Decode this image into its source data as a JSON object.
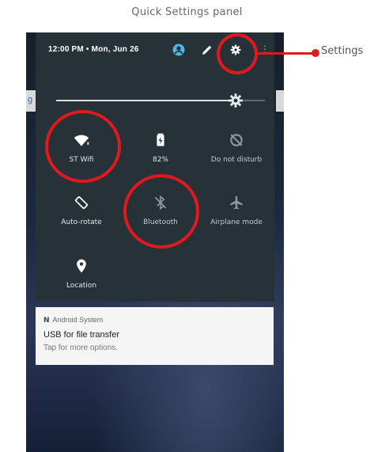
{
  "caption": "Quick Settings panel",
  "status_bar": {
    "datetime": "12:00 PM • Mon, Jun 26",
    "more": "⋮"
  },
  "brightness": {
    "level": 0.86
  },
  "tiles": [
    {
      "label": "ST Wifi",
      "icon": "wifi-icon"
    },
    {
      "label": "82%",
      "icon": "battery-icon"
    },
    {
      "label": "Do not disturb",
      "icon": "do-not-disturb-icon"
    },
    {
      "label": "Auto-rotate",
      "icon": "auto-rotate-icon"
    },
    {
      "label": "Bluetooth",
      "icon": "bluetooth-icon"
    },
    {
      "label": "Airplane mode",
      "icon": "airplane-icon"
    },
    {
      "label": "Location",
      "icon": "location-icon"
    }
  ],
  "notification": {
    "app_icon": "N",
    "app": "Android System",
    "title": "USB for file transfer",
    "subtitle": "Tap for more options."
  },
  "callout": {
    "label": "Settings"
  },
  "colors": {
    "panel": "#263238",
    "highlight": "#e0191e",
    "notification_bg": "#f5f5f5"
  }
}
